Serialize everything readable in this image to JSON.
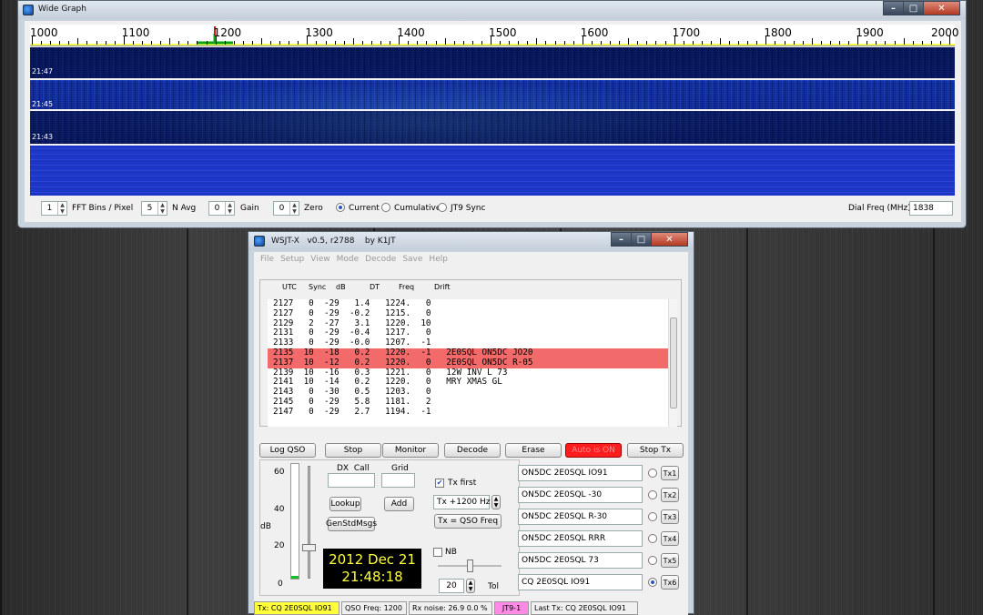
{
  "colors": {
    "highlight_row": "#f26a6a",
    "auto_on_button": "#ff1d1d",
    "clock_text": "#ffff3c",
    "tx_status": "#ffff3c",
    "mode_status": "#ff8ae6"
  },
  "wide_graph": {
    "title": "Wide Graph",
    "freq_labels": [
      "1000",
      "1100",
      "1200",
      "1300",
      "1400",
      "1500",
      "1600",
      "1700",
      "1800",
      "1900",
      "2000"
    ],
    "time_labels": [
      "21:47",
      "21:45",
      "21:43"
    ],
    "controls": {
      "fft_bins_value": "1",
      "fft_bins_label": "FFT Bins / Pixel",
      "navg_value": "5",
      "navg_label": "N Avg",
      "gain_value": "0",
      "gain_label": "Gain",
      "zero_value": "0",
      "zero_label": "Zero",
      "current_label": "Current",
      "cumulative_label": "Cumulative",
      "jt9sync_label": "JT9 Sync",
      "selected_mode": "Current",
      "dial_freq_label": "Dial Freq (MHz)",
      "dial_freq_value": "1838"
    }
  },
  "wsjtx": {
    "title": "WSJT-X   v0.5, r2788    by K1JT",
    "menu": [
      "File",
      "Setup",
      "View",
      "Mode",
      "Decode",
      "Save",
      "Help"
    ],
    "columns": [
      "UTC",
      "Sync",
      "dB",
      "DT",
      "Freq",
      "Drift"
    ],
    "decodes": [
      {
        "text": "2127   0  -29   1.4   1224.   0",
        "highlight": false
      },
      {
        "text": "2127   0  -29  -0.2   1215.   0",
        "highlight": false
      },
      {
        "text": "2129   2  -27   3.1   1220.  10",
        "highlight": false
      },
      {
        "text": "2131   0  -29  -0.4   1217.   0",
        "highlight": false
      },
      {
        "text": "2133   0  -29  -0.0   1207.  -1",
        "highlight": false
      },
      {
        "text": "2135  10  -18   0.2   1220.  -1   2E0SQL ON5DC JO20",
        "highlight": true
      },
      {
        "text": "2137  10  -12   0.2   1220.   0   2E0SQL ON5DC R-05",
        "highlight": true
      },
      {
        "text": "2139  10  -16   0.3   1221.   0   12W INV L 73",
        "highlight": false
      },
      {
        "text": "2141  10  -14   0.2   1220.   0   MRY XMAS GL",
        "highlight": false
      },
      {
        "text": "2143   0  -30   0.5   1203.   0",
        "highlight": false
      },
      {
        "text": "2145   0  -29   5.8   1181.   2",
        "highlight": false
      },
      {
        "text": "2147   0  -29   2.7   1194.  -1",
        "highlight": false
      }
    ],
    "buttons": {
      "log_qso": "Log QSO",
      "stop": "Stop",
      "monitor": "Monitor",
      "decode": "Decode",
      "erase": "Erase",
      "auto_on": "Auto is ON",
      "stop_tx": "Stop Tx",
      "lookup": "Lookup",
      "add": "Add",
      "gen_std_msgs": "GenStdMsgs",
      "tx_eq_qso": "Tx = QSO Freq"
    },
    "meter_labels": [
      "60",
      "40",
      "20",
      "0"
    ],
    "meter_unit": "dB",
    "meter_level_fraction": 0.02,
    "dx_call_label": "DX  Call",
    "grid_label": "Grid",
    "dx_call_value": "",
    "grid_value": "",
    "tx_first_label": "Tx first",
    "tx_first_checked": true,
    "tx_offset": "Tx +1200  Hz",
    "nb_label": "NB",
    "nb_checked": false,
    "tol_value": "20",
    "tol_label": "Tol",
    "clock_date": "2012 Dec 21",
    "clock_time": "21:48:18",
    "tx_messages": [
      {
        "text": "ON5DC 2E0SQL IO91",
        "label": "Tx1",
        "selected": false
      },
      {
        "text": "ON5DC 2E0SQL -30",
        "label": "Tx2",
        "selected": false
      },
      {
        "text": "ON5DC 2E0SQL R-30",
        "label": "Tx3",
        "selected": false
      },
      {
        "text": "ON5DC 2E0SQL RRR",
        "label": "Tx4",
        "selected": false
      },
      {
        "text": "ON5DC 2E0SQL 73",
        "label": "Tx5",
        "selected": false
      },
      {
        "text": "CQ 2E0SQL IO91",
        "label": "Tx6",
        "selected": true
      }
    ],
    "status": {
      "tx": "Tx: CQ 2E0SQL IO91",
      "qso_freq": "QSO Freq:  1200",
      "rx_noise": "Rx noise:  26.9   0.0 %",
      "mode": "JT9-1",
      "last_tx": "Last Tx:  CQ 2E0SQL IO91"
    }
  }
}
